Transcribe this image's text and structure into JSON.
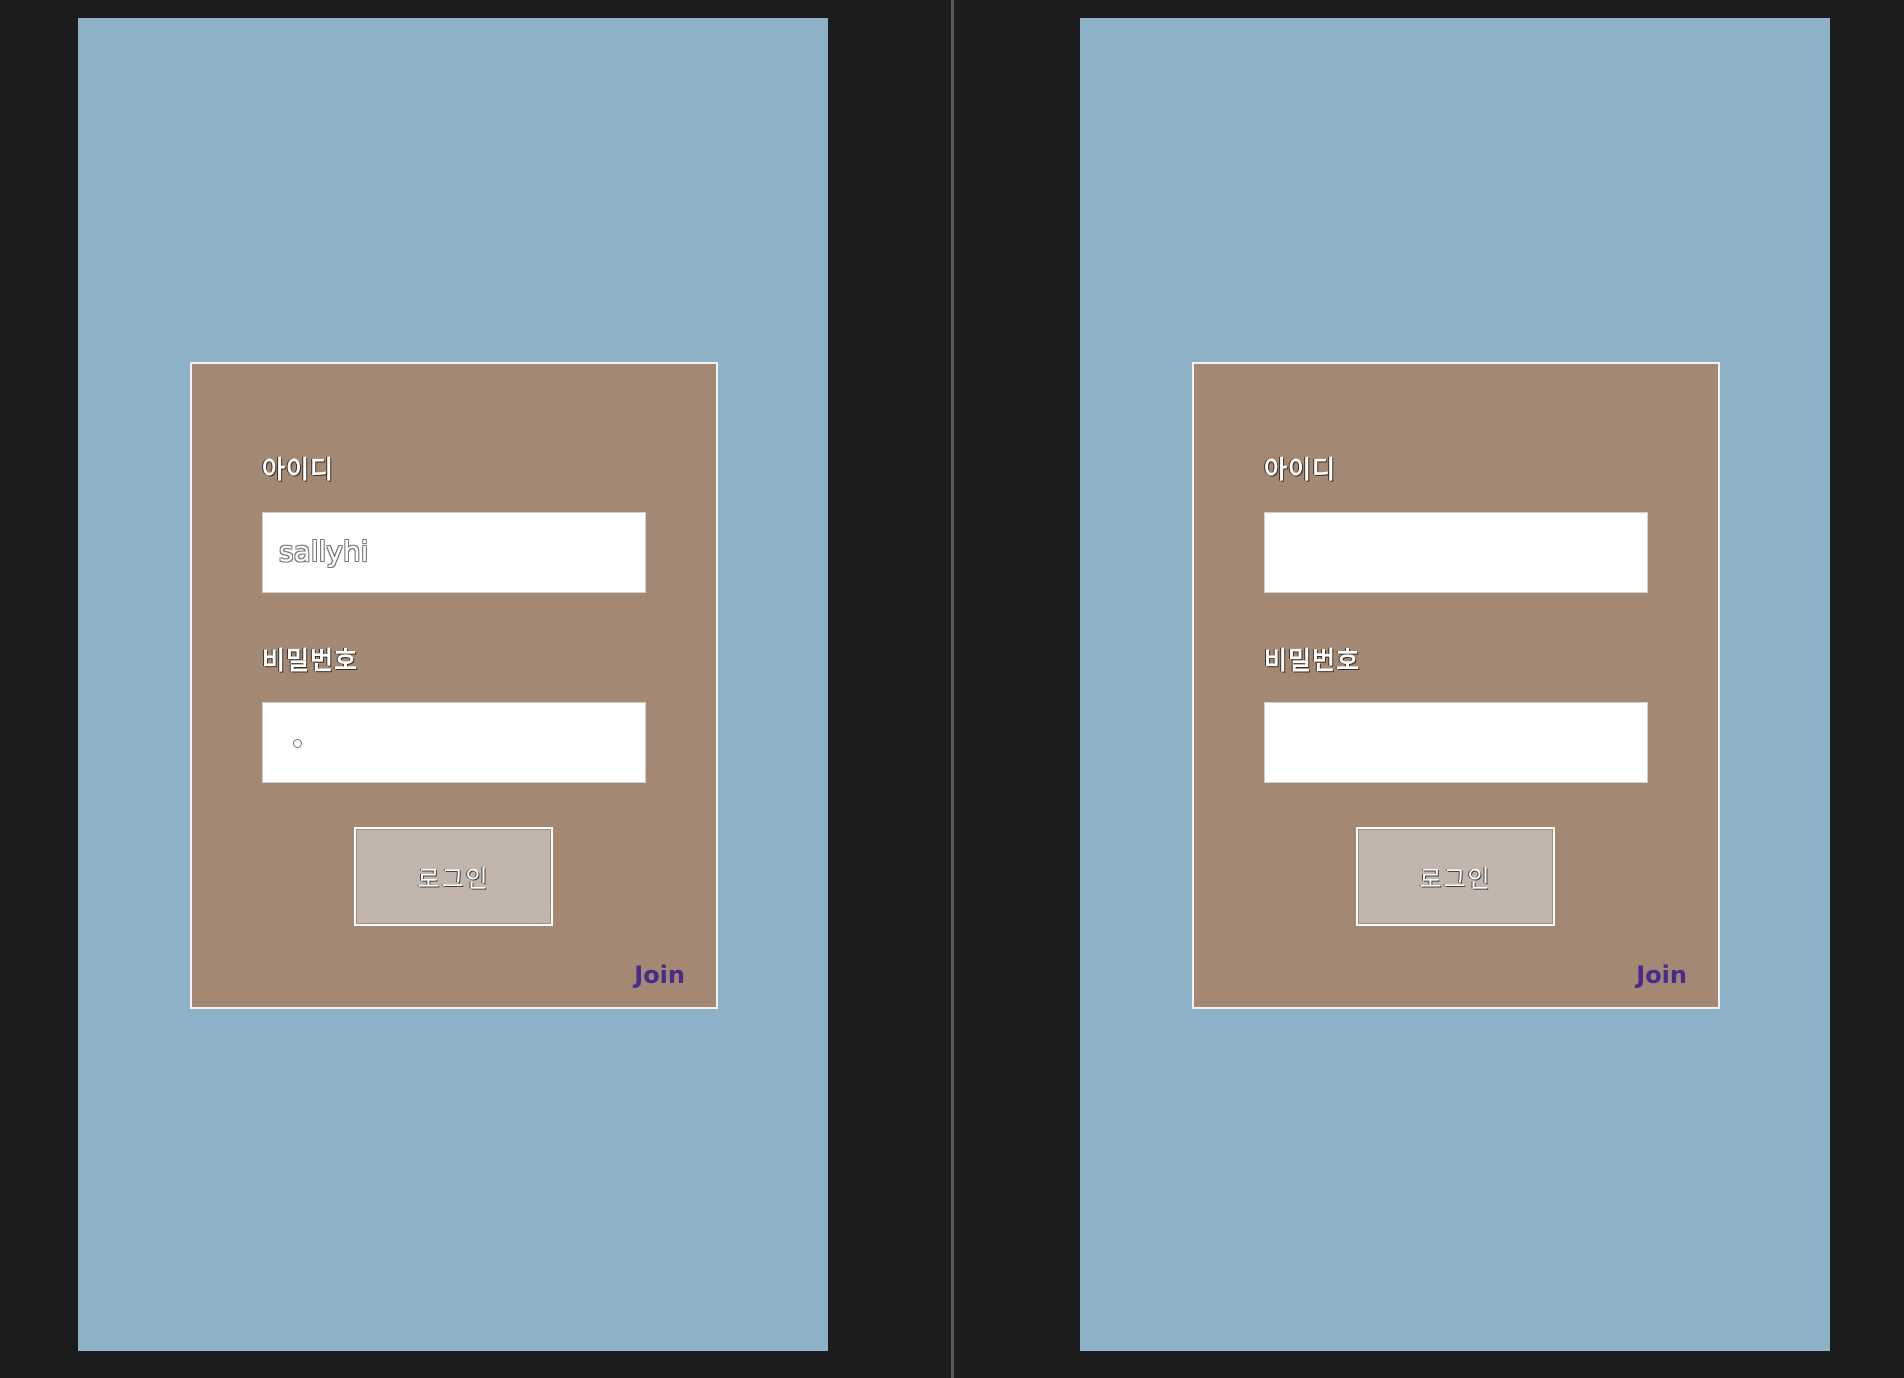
{
  "screens": [
    {
      "id_label": "아이디",
      "id_value": "sallyhi",
      "password_label": "비밀번호",
      "password_masked": true,
      "login_button": "로그인",
      "join_link": "Join"
    },
    {
      "id_label": "아이디",
      "id_value": "",
      "password_label": "비밀번호",
      "password_masked": false,
      "login_button": "로그인",
      "join_link": "Join"
    }
  ],
  "colors": {
    "background": "#1c1c1d",
    "screen": "#8db1c7",
    "panel": "#a38873",
    "button": "#c2b6ac",
    "join_link": "#4b2a8a"
  }
}
